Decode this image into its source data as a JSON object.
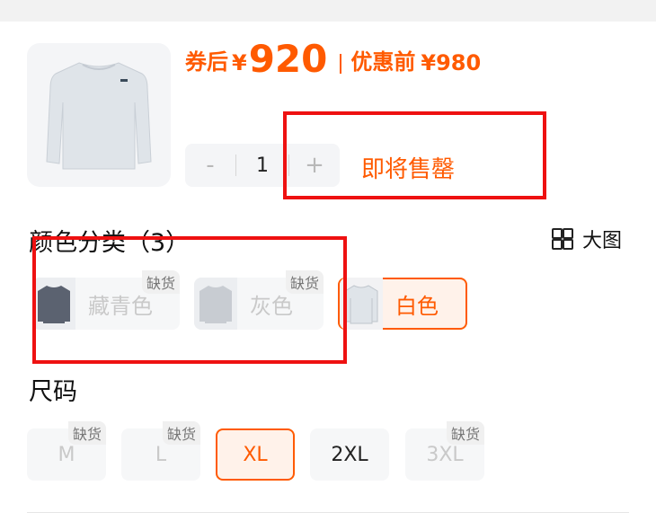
{
  "product": {
    "price_label": "券后",
    "currency": "¥",
    "price": "920",
    "original_label": "优惠前",
    "original_price": "¥980",
    "quantity": "1",
    "minus_label": "-",
    "plus_label": "+",
    "status_text": "即将售罄"
  },
  "color_section": {
    "title": "颜色分类（3）",
    "big_image_label": "大图",
    "options": [
      {
        "name": "藏青色",
        "badge": "缺货",
        "state": "disabled"
      },
      {
        "name": "灰色",
        "badge": "缺货",
        "state": "disabled"
      },
      {
        "name": "白色",
        "badge": "",
        "state": "selected"
      }
    ]
  },
  "size_section": {
    "title": "尺码",
    "options": [
      {
        "name": "M",
        "badge": "缺货",
        "state": "disabled"
      },
      {
        "name": "L",
        "badge": "缺货",
        "state": "disabled"
      },
      {
        "name": "XL",
        "badge": "",
        "state": "selected"
      },
      {
        "name": "2XL",
        "badge": "",
        "state": "available"
      },
      {
        "name": "3XL",
        "badge": "缺货",
        "state": "disabled"
      }
    ]
  },
  "colors": {
    "accent": "#ff5a00",
    "annotation": "#ee1111"
  }
}
